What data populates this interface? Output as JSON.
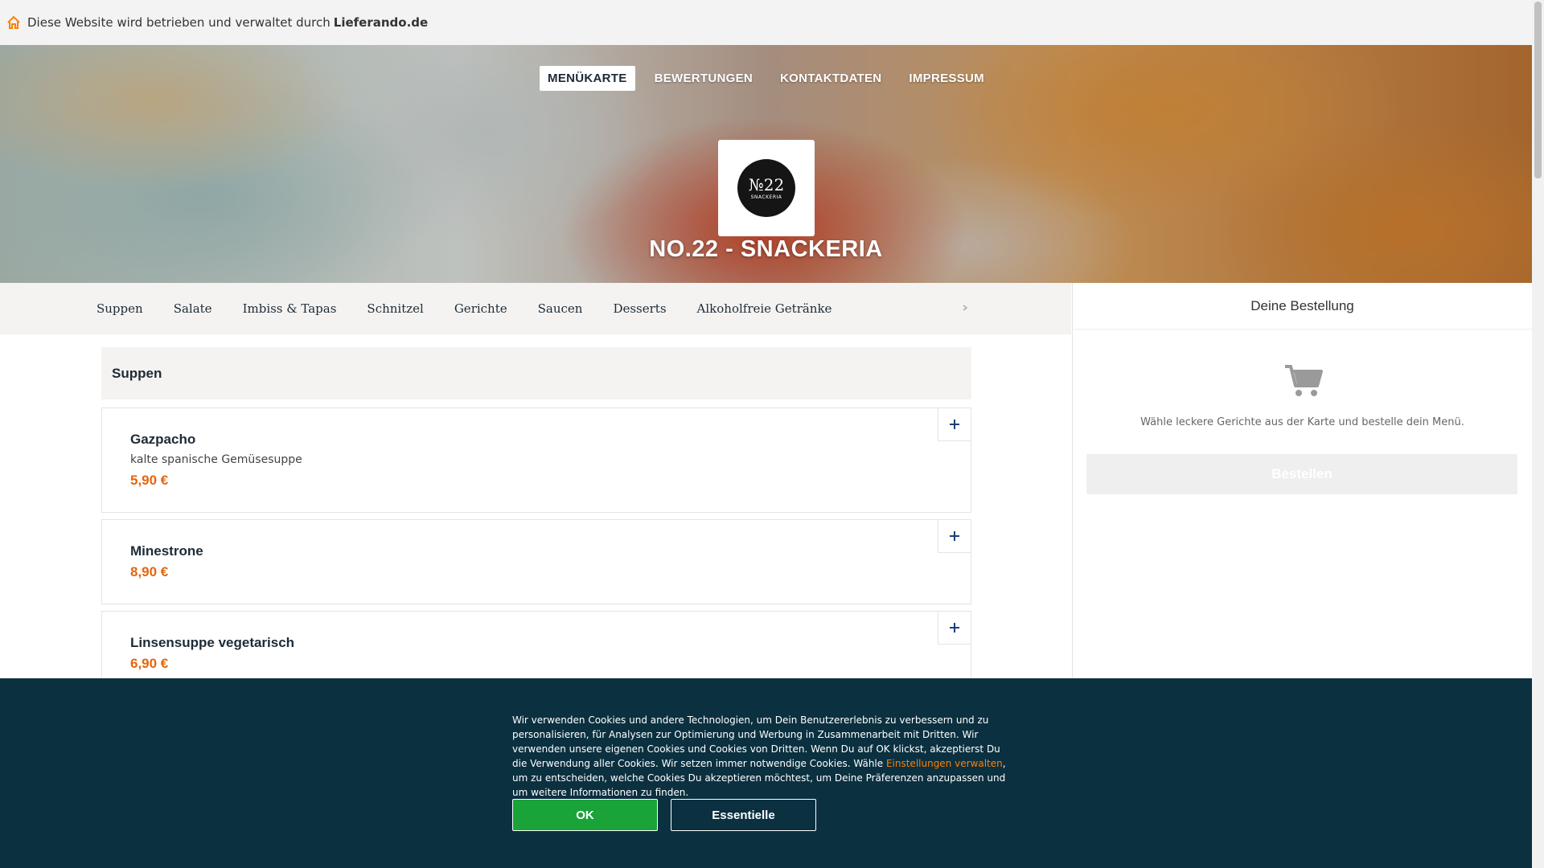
{
  "topbar": {
    "text": "Diese Website wird betrieben und verwaltet durch",
    "brand": "Lieferando.de",
    "icon": "home-icon"
  },
  "hero": {
    "nav": [
      "MENÜKARTE",
      "BEWERTUNGEN",
      "KONTAKTDATEN",
      "IMPRESSUM"
    ],
    "logo_number": "№22",
    "logo_sub": "SNACKERIA",
    "title": "NO.22 - SNACKERIA"
  },
  "categories": [
    "Suppen",
    "Salate",
    "Imbiss & Tapas",
    "Schnitzel",
    "Gerichte",
    "Saucen",
    "Desserts",
    "Alkoholfreie Getränke"
  ],
  "section": {
    "title": "Suppen"
  },
  "items": [
    {
      "name": "Gazpacho",
      "desc": "kalte spanische Gemüsesuppe",
      "price": "5,90 €"
    },
    {
      "name": "Minestrone",
      "desc": "",
      "price": "8,90 €"
    },
    {
      "name": "Linsensuppe vegetarisch",
      "desc": "",
      "price": "6,90 €"
    }
  ],
  "cart": {
    "title": "Deine Bestellung",
    "empty_message": "Wähle leckere Gerichte aus der Karte und bestelle dein Menü.",
    "order_label": "Bestellen",
    "icon": "cart-icon"
  },
  "cookie": {
    "text_before": "Wir verwenden Cookies und andere Technologien, um Dein Benutzererlebnis zu verbessern und zu personalisieren, für Analysen zur Optimierung und Werbung in Zusammenarbeit mit Dritten. Wir verwenden unsere eigenen Cookies und Cookies von Dritten. Wenn Du auf OK klickst, akzeptierst Du die Verwendung aller Cookies. Wir setzen immer notwendige Cookies. Wähle ",
    "link": "Einstellungen verwalten",
    "text_after": ", um zu entscheiden, welche Cookies Du akzeptieren möchtest, um Deine Präferenzen anzupassen und um weitere Informationen zu finden.",
    "ok_label": "OK",
    "essential_label": "Essentielle"
  },
  "colors": {
    "accent": "#e8640c",
    "ok_green": "#19a339",
    "banner": "#0b3040",
    "link_orange": "#ff8000"
  }
}
